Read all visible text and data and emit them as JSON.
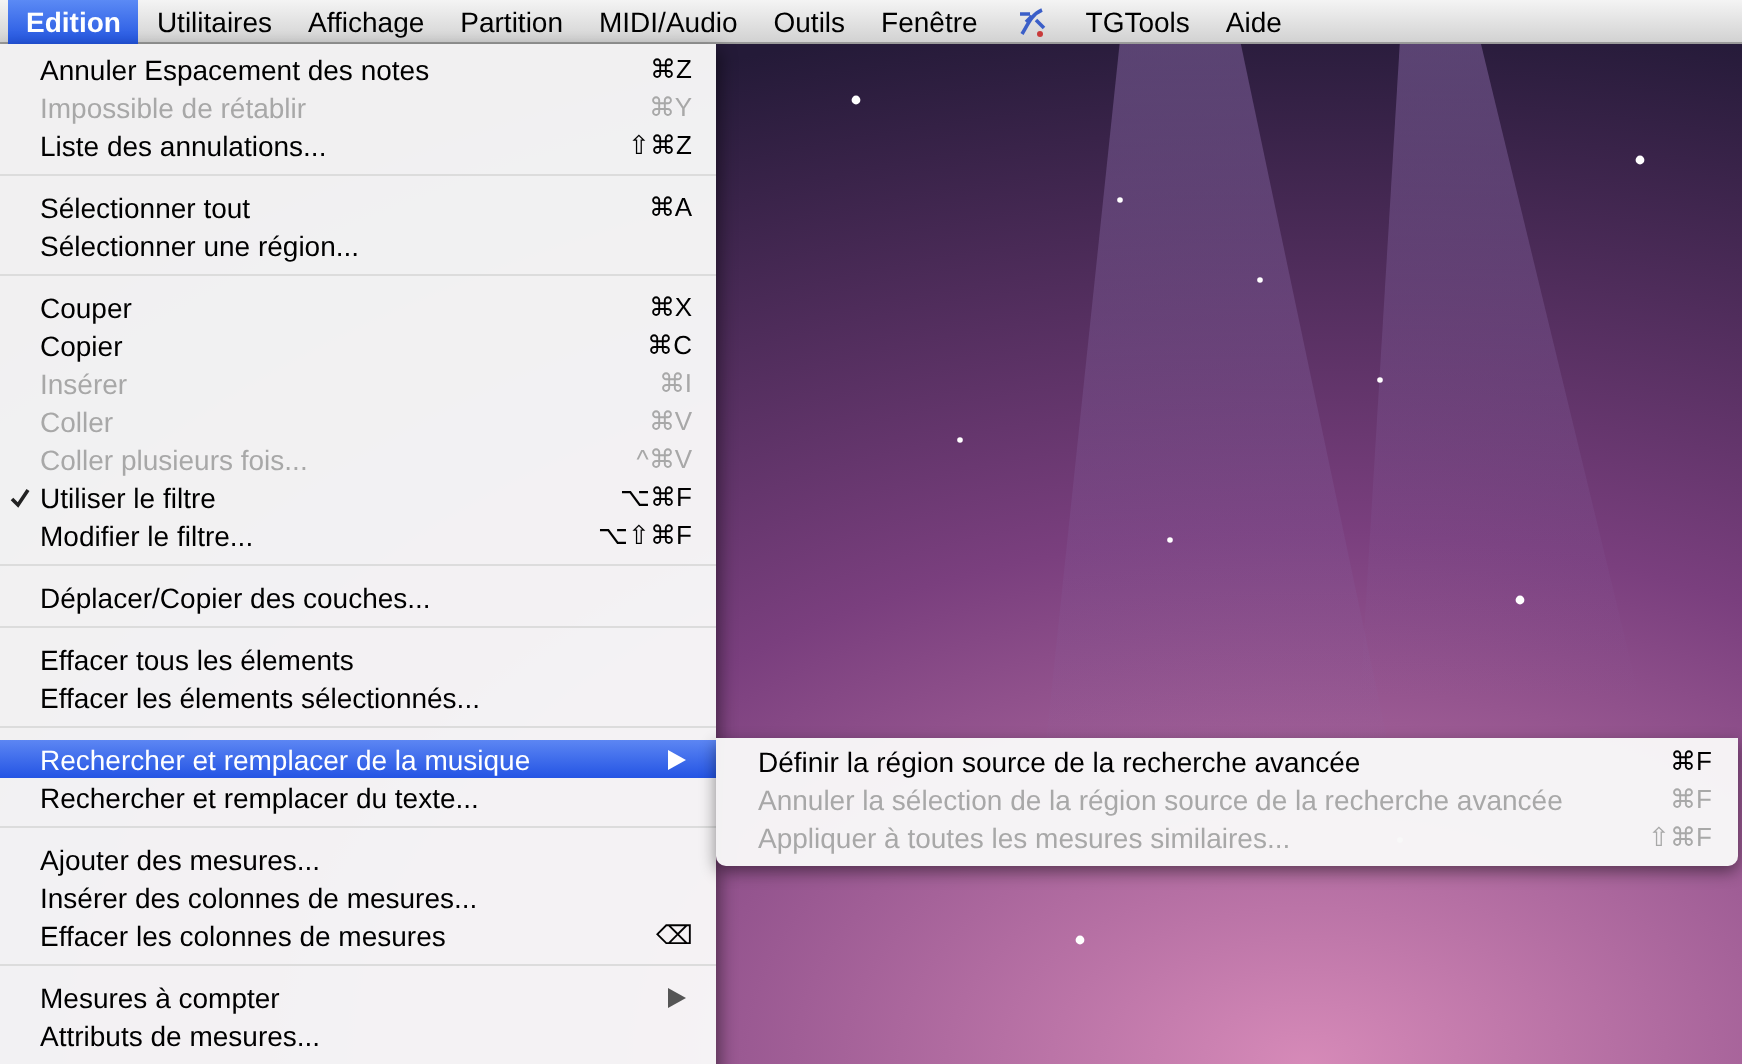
{
  "menubar": [
    {
      "kind": "text",
      "label": "Edition",
      "selected": true
    },
    {
      "kind": "text",
      "label": "Utilitaires",
      "selected": false
    },
    {
      "kind": "text",
      "label": "Affichage",
      "selected": false
    },
    {
      "kind": "text",
      "label": "Partition",
      "selected": false
    },
    {
      "kind": "text",
      "label": "MIDI/Audio",
      "selected": false
    },
    {
      "kind": "text",
      "label": "Outils",
      "selected": false
    },
    {
      "kind": "text",
      "label": "Fenêtre",
      "selected": false
    },
    {
      "kind": "icon",
      "selected": false
    },
    {
      "kind": "text",
      "label": "TGTools",
      "selected": false
    },
    {
      "kind": "text",
      "label": "Aide",
      "selected": false
    }
  ],
  "menu": {
    "sections": [
      [
        {
          "label": "Annuler Espacement des notes",
          "shortcut": "⌘Z",
          "disabled": false,
          "checked": false,
          "selected": false,
          "submenu": false
        },
        {
          "label": "Impossible de rétablir",
          "shortcut": "⌘Y",
          "disabled": true,
          "checked": false,
          "selected": false,
          "submenu": false
        },
        {
          "label": "Liste des annulations...",
          "shortcut": "⇧⌘Z",
          "disabled": false,
          "checked": false,
          "selected": false,
          "submenu": false
        }
      ],
      [
        {
          "label": "Sélectionner tout",
          "shortcut": "⌘A",
          "disabled": false,
          "checked": false,
          "selected": false,
          "submenu": false
        },
        {
          "label": "Sélectionner une région...",
          "disabled": false,
          "checked": false,
          "selected": false,
          "submenu": false
        }
      ],
      [
        {
          "label": "Couper",
          "shortcut": "⌘X",
          "disabled": false,
          "checked": false,
          "selected": false,
          "submenu": false
        },
        {
          "label": "Copier",
          "shortcut": "⌘C",
          "disabled": false,
          "checked": false,
          "selected": false,
          "submenu": false
        },
        {
          "label": "Insérer",
          "shortcut": "⌘I",
          "disabled": true,
          "checked": false,
          "selected": false,
          "submenu": false
        },
        {
          "label": "Coller",
          "shortcut": "⌘V",
          "disabled": true,
          "checked": false,
          "selected": false,
          "submenu": false
        },
        {
          "label": "Coller plusieurs fois...",
          "shortcut": "^⌘V",
          "disabled": true,
          "checked": false,
          "selected": false,
          "submenu": false
        },
        {
          "label": "Utiliser le filtre",
          "shortcut": "⌥⌘F",
          "disabled": false,
          "checked": true,
          "selected": false,
          "submenu": false
        },
        {
          "label": "Modifier le filtre...",
          "shortcut": "⌥⇧⌘F",
          "disabled": false,
          "checked": false,
          "selected": false,
          "submenu": false
        }
      ],
      [
        {
          "label": "Déplacer/Copier des couches...",
          "disabled": false,
          "checked": false,
          "selected": false,
          "submenu": false
        }
      ],
      [
        {
          "label": "Effacer tous les élements",
          "disabled": false,
          "checked": false,
          "selected": false,
          "submenu": false
        },
        {
          "label": "Effacer les élements sélectionnés...",
          "disabled": false,
          "checked": false,
          "selected": false,
          "submenu": false
        }
      ],
      [
        {
          "label": "Rechercher et remplacer de la musique",
          "disabled": false,
          "checked": false,
          "selected": true,
          "submenu": true
        },
        {
          "label": "Rechercher et remplacer du texte...",
          "disabled": false,
          "checked": false,
          "selected": false,
          "submenu": false
        }
      ],
      [
        {
          "label": "Ajouter des mesures...",
          "disabled": false,
          "checked": false,
          "selected": false,
          "submenu": false
        },
        {
          "label": "Insérer des colonnes de mesures...",
          "disabled": false,
          "checked": false,
          "selected": false,
          "submenu": false
        },
        {
          "label": "Effacer les colonnes de mesures",
          "shortcut": "⌫",
          "disabled": false,
          "checked": false,
          "selected": false,
          "submenu": false
        }
      ],
      [
        {
          "label": "Mesures à compter",
          "disabled": false,
          "checked": false,
          "selected": false,
          "submenu": true
        },
        {
          "label": "Attributs de mesures...",
          "disabled": false,
          "checked": false,
          "selected": false,
          "submenu": false
        }
      ]
    ]
  },
  "submenu": {
    "items": [
      {
        "label": "Définir la région source de la recherche avancée",
        "shortcut": "⌘F",
        "disabled": false
      },
      {
        "label": "Annuler la sélection de la région source de la recherche avancée",
        "shortcut": "⌘F",
        "disabled": true
      },
      {
        "label": "Appliquer à toutes les mesures similaires...",
        "shortcut": "⇧⌘F",
        "disabled": true
      }
    ]
  }
}
